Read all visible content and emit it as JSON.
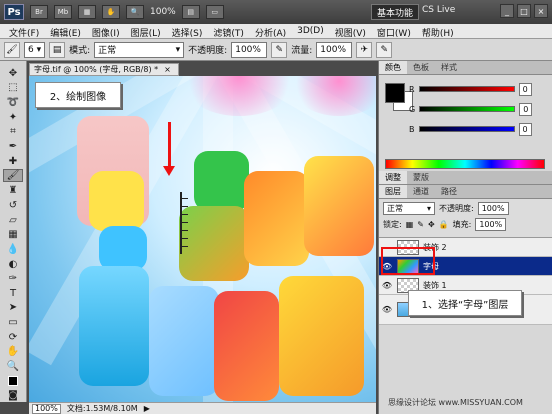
{
  "app": {
    "logo": "Ps",
    "top_buttons": [
      "Br",
      "Mb"
    ],
    "zoom": "100%",
    "workspace": "基本功能",
    "cslive": "CS Live",
    "window_buttons": [
      "_",
      "□",
      "×"
    ]
  },
  "menu": [
    "文件(F)",
    "编辑(E)",
    "图像(I)",
    "图层(L)",
    "选择(S)",
    "滤镜(T)",
    "分析(A)",
    "3D(D)",
    "视图(V)",
    "窗口(W)",
    "帮助(H)"
  ],
  "options": {
    "brush_size": "6",
    "mode_label": "模式:",
    "mode_value": "正常",
    "opacity_label": "不透明度:",
    "opacity_value": "100%",
    "flow_label": "流量:",
    "flow_value": "100%"
  },
  "document": {
    "tab_title": "字母.tif @ 100% (字母, RGB/8) *",
    "close": "×",
    "step_callout": "2、绘制图像",
    "status_zoom": "100%",
    "status_doc": "文档:1.53M/8.10M"
  },
  "panel": {
    "color_tabs": [
      "颜色",
      "色板",
      "样式"
    ],
    "channels": [
      "R",
      "G",
      "B"
    ],
    "channel_values": [
      "0",
      "0",
      "0"
    ],
    "adjust_tabs": [
      "调整",
      "蒙版"
    ],
    "layer_tabs": [
      "图层",
      "通道",
      "路径"
    ],
    "blend_mode": "正常",
    "opacity_label": "不透明度:",
    "opacity_value": "100%",
    "lock_label": "锁定:",
    "fill_label": "填充:",
    "fill_value": "100%",
    "layers": [
      {
        "name": "装饰 2",
        "visible": false,
        "selected": false
      },
      {
        "name": "字母",
        "visible": true,
        "selected": true
      },
      {
        "name": "装饰 1",
        "visible": true,
        "selected": false
      }
    ]
  },
  "callout_select": "1、选择“字母”图层",
  "watermark": "思缘设计论坛 www.MISSYUAN.COM"
}
